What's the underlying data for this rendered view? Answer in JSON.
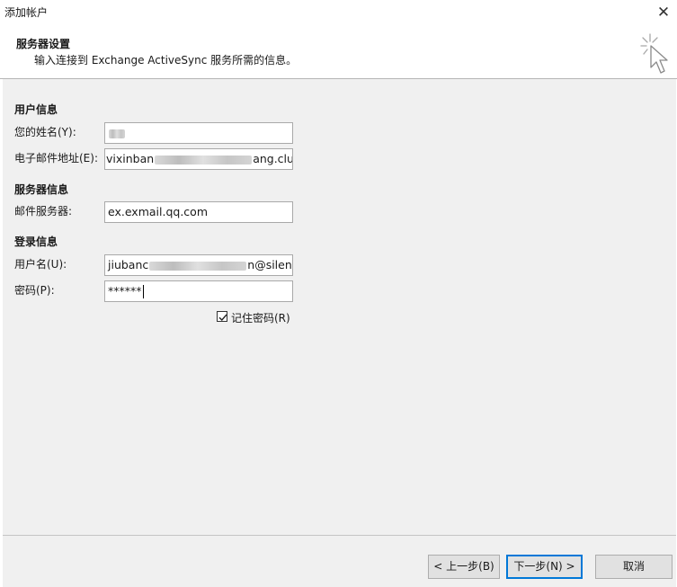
{
  "window": {
    "title": "添加帐户",
    "close_glyph": "✕"
  },
  "header": {
    "title": "服务器设置",
    "subtitle": "输入连接到 Exchange ActiveSync 服务所需的信息。",
    "icon": "cursor-click-icon"
  },
  "user_info": {
    "heading": "用户信息",
    "name_label": "您的姓名(Y):",
    "email_label": "电子邮件地址(E):",
    "email_prefix": "vixinban",
    "email_suffix": "ang.club"
  },
  "server_info": {
    "heading": "服务器信息",
    "server_label": "邮件服务器:",
    "server_value": "ex.exmail.qq.com"
  },
  "login_info": {
    "heading": "登录信息",
    "username_label": "用户名(U):",
    "username_prefix": "jiubanc",
    "username_suffix": "n@silenc",
    "password_label": "密码(P):",
    "password_value": "******",
    "remember_label": "记住密码(R)",
    "remember_checked": true
  },
  "buttons": {
    "back": "< 上一步(B)",
    "next": "下一步(N) >",
    "cancel": "取消"
  },
  "colors": {
    "panel": "#f0f0f0",
    "accent": "#0078d7"
  }
}
